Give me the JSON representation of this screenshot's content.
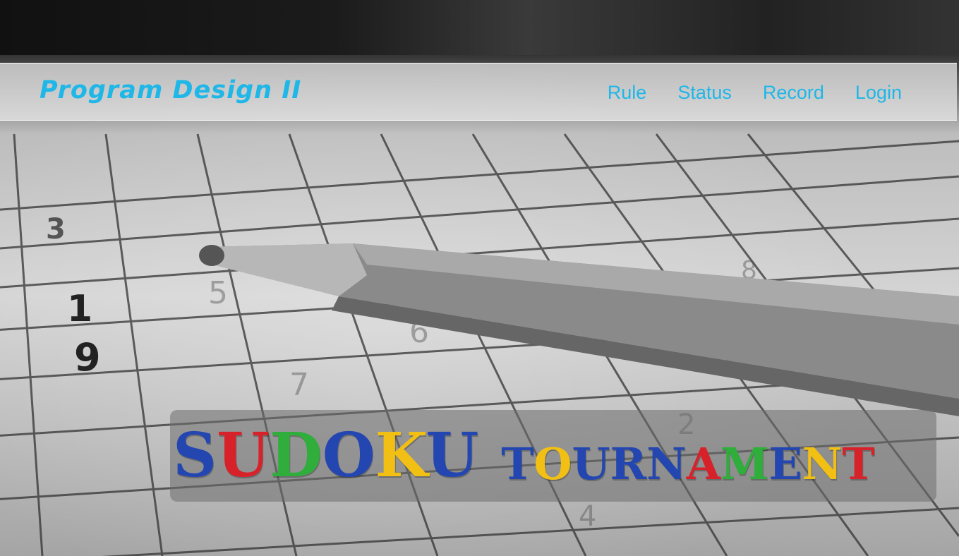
{
  "navbar": {
    "brand": "Program Design II",
    "links": [
      {
        "label": "Rule"
      },
      {
        "label": "Status"
      },
      {
        "label": "Record"
      },
      {
        "label": "Login"
      }
    ]
  },
  "hero": {
    "title_word_1": "SUDOKU",
    "title_word_2": "TOURNAMENT",
    "letter_colors": {
      "blue": "#2446b0",
      "red": "#d8222a",
      "green": "#2fae3b",
      "yellow": "#f2c014"
    }
  },
  "background": {
    "description_icon": "sudoku-grid-with-pencil-image",
    "grid_digits": [
      "3",
      "1",
      "9",
      "5",
      "6",
      "7",
      "8",
      "2",
      "4"
    ]
  }
}
